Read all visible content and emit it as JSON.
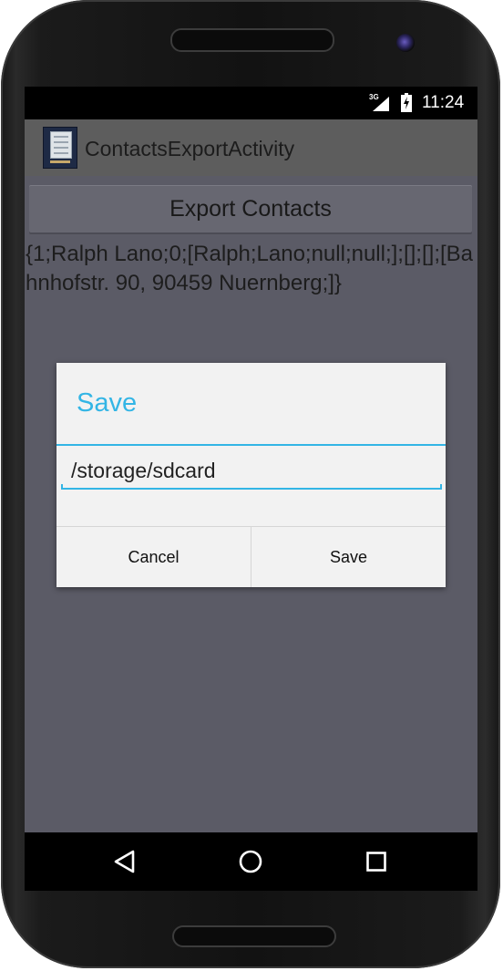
{
  "status_bar": {
    "network": "3G",
    "time": "11:24",
    "signal_icon": "signal-icon",
    "battery_icon": "battery-charging-icon"
  },
  "action_bar": {
    "app_icon": "app-icon",
    "title": "ContactsExportActivity"
  },
  "main": {
    "export_button_label": "Export Contacts",
    "contact_output": "{1;Ralph Lano;0;[Ralph;Lano;null;null;];[];[];[Bahnhofstr. 90, 90459 Nuernberg;]}"
  },
  "dialog": {
    "title": "Save",
    "path_value": "/storage/sdcard",
    "cancel_label": "Cancel",
    "save_label": "Save",
    "accent_color": "#33b5e5"
  },
  "nav_bar": {
    "back_icon": "back-triangle-icon",
    "home_icon": "home-circle-icon",
    "recents_icon": "recents-square-icon"
  }
}
